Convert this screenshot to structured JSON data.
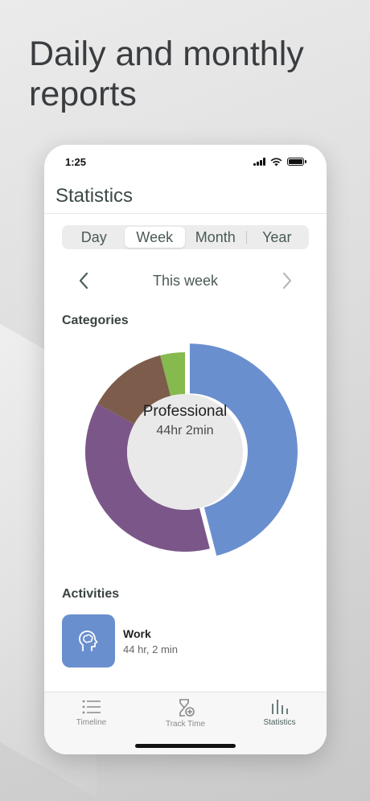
{
  "headline": "Daily and monthly reports",
  "status_bar": {
    "time": "1:25"
  },
  "header": {
    "title": "Statistics"
  },
  "segments": [
    {
      "label": "Day",
      "active": false
    },
    {
      "label": "Week",
      "active": true
    },
    {
      "label": "Month",
      "active": false
    },
    {
      "label": "Year",
      "active": false
    }
  ],
  "period": {
    "label": "This week",
    "prev_icon": "chevron-left-icon",
    "next_icon": "chevron-right-icon"
  },
  "categories": {
    "label": "Categories",
    "selected": {
      "name": "Professional",
      "time": "44hr 2min"
    }
  },
  "chart_data": {
    "type": "pie",
    "series": [
      {
        "value": 46,
        "color": "#6a8fcf",
        "exploded": true
      },
      {
        "value": 37,
        "color": "#7b5688"
      },
      {
        "value": 13,
        "color": "#7d5c4c"
      },
      {
        "value": 4,
        "color": "#86b94e"
      }
    ]
  },
  "activities": {
    "label": "Activities",
    "items": [
      {
        "title": "Work",
        "subtitle": "44 hr, 2 min",
        "icon": "brain-head-icon",
        "color": "#6a8fcf"
      }
    ]
  },
  "tabs": [
    {
      "label": "Timeline",
      "icon": "list-icon",
      "active": false
    },
    {
      "label": "Track Time",
      "icon": "hourglass-add-icon",
      "active": false
    },
    {
      "label": "Statistics",
      "icon": "bar-chart-icon",
      "active": true
    }
  ],
  "colors": {
    "accent": "#4a5f5c",
    "activity_bg": "#6a8fcf"
  }
}
